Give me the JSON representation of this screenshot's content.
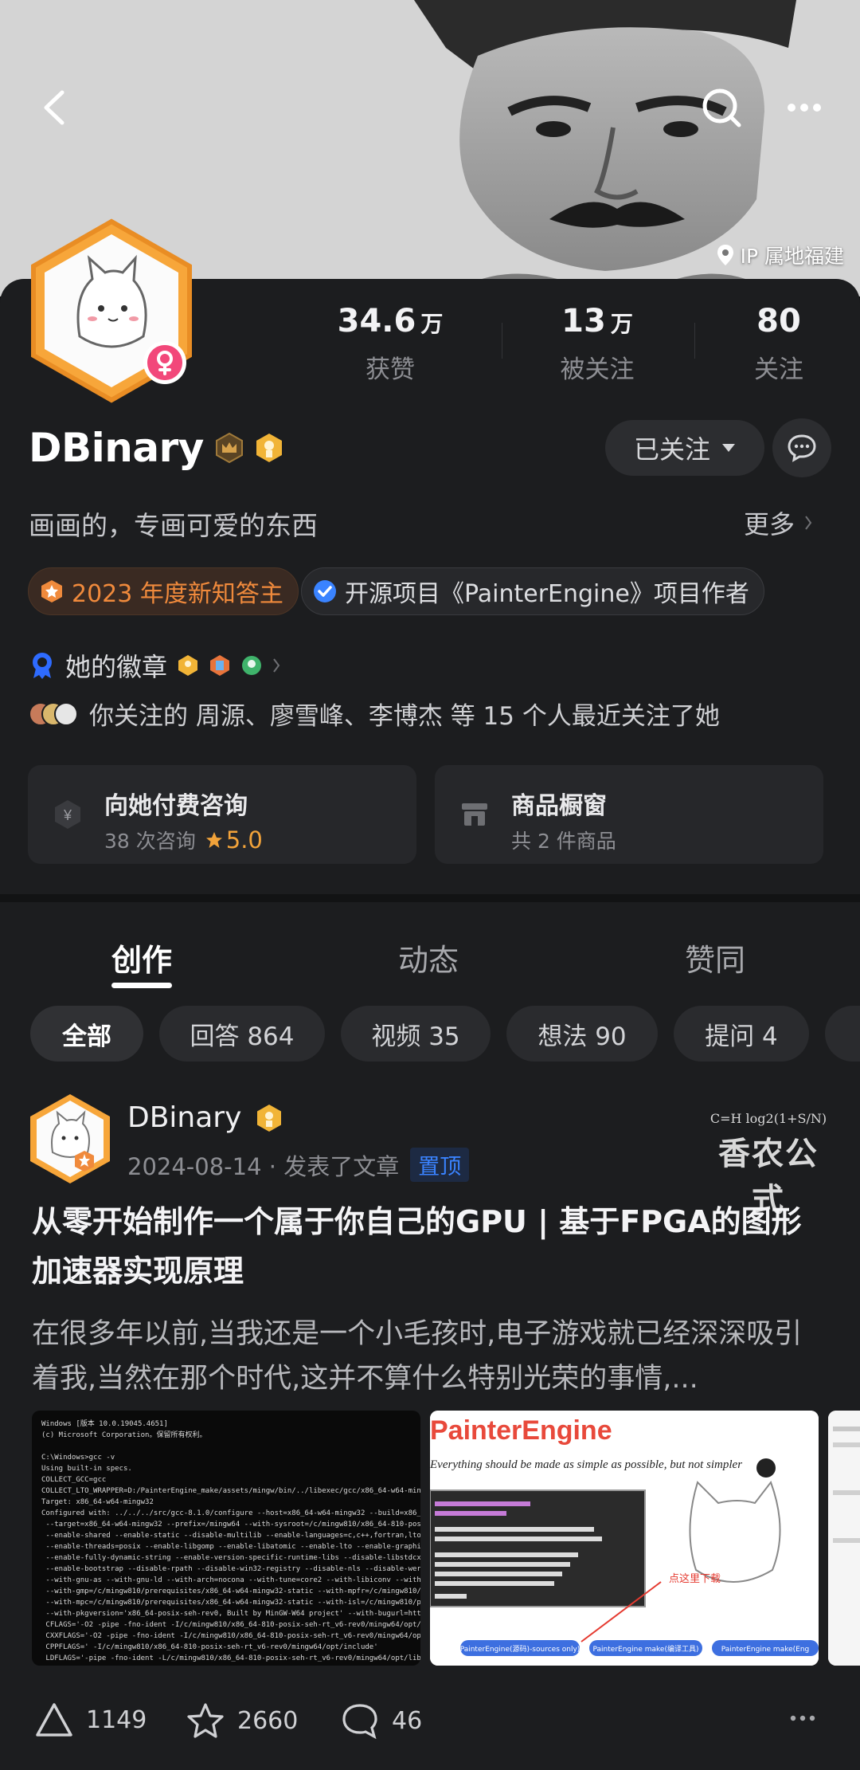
{
  "cover": {
    "ip_location": "IP 属地福建"
  },
  "profile": {
    "stats": [
      {
        "num": "34.6",
        "unit": "万",
        "label": "获赞"
      },
      {
        "num": "13",
        "unit": "万",
        "label": "被关注"
      },
      {
        "num": "80",
        "unit": "",
        "label": "关注"
      }
    ],
    "name": "DBinary",
    "follow_label": "已关注",
    "bio": "画画的，专画可爱的东西",
    "more_label": "更多",
    "tags": [
      {
        "label": "2023 年度新知答主"
      },
      {
        "label": "开源项目《PainterEngine》项目作者"
      }
    ],
    "badges_label": "她的徽章",
    "friends_text": "你关注的 周源、廖雪峰、李博杰 等 15 个人最近关注了她",
    "services": [
      {
        "title": "向她付费咨询",
        "sub": "38 次咨询",
        "rating": "5.0"
      },
      {
        "title": "商品橱窗",
        "sub": "共 2 件商品"
      }
    ]
  },
  "tabs": [
    {
      "label": "创作"
    },
    {
      "label": "动态"
    },
    {
      "label": "赞同"
    }
  ],
  "filters": [
    {
      "label": "全部"
    },
    {
      "label": "回答 864"
    },
    {
      "label": "视频 35"
    },
    {
      "label": "想法 90"
    },
    {
      "label": "提问 4"
    }
  ],
  "post": {
    "author": "DBinary",
    "meta": "2024-08-14 · 发表了文章",
    "pin_label": "置顶",
    "logo_formula": "C=H log2(1+S/N)",
    "logo_text": "香农公式",
    "title": "从零开始制作一个属于你自己的GPU | 基于FPGA的图形加速器实现原理",
    "excerpt": "在很多年以前,当我还是一个小毛孩时,电子游戏就已经深深吸引着我,当然在那个时代,这并不算什么特别光荣的事情,...",
    "thumb2_title": "PainterEngine",
    "thumb2_slogan": "Everything should be made as simple as possible, but not simpler",
    "thumb2_note": "点这里下载",
    "thumb2_buttons": [
      "PainterEngine(源码)-sources only)",
      "PainterEngine make(编译工具)",
      "PainterEngine make(Eng"
    ],
    "likes": "1149",
    "favorites": "2660",
    "comments": "46"
  },
  "colors": {
    "accent_orange": "#f08a3c",
    "accent_blue": "#3a83ff",
    "card_bg": "#1c1d1f",
    "gender_pink": "#f2487a"
  }
}
